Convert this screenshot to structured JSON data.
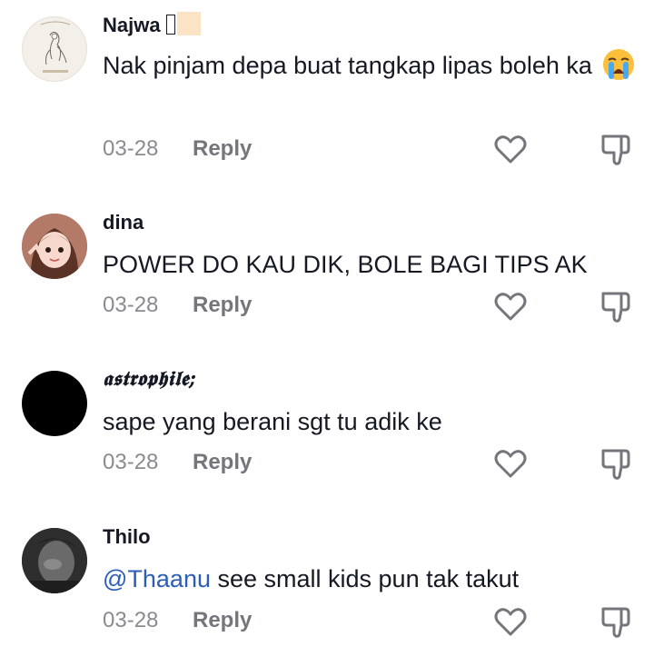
{
  "comments": [
    {
      "username": "Najwa",
      "text": "Nak pinjam depa buat tangkap lipas boleh ka",
      "emoji": "loudly-crying-face",
      "date": "03-28",
      "reply_label": "Reply"
    },
    {
      "username": "dina",
      "text": "POWER DO KAU DIK, BOLE BAGI TIPS AK",
      "date": "03-28",
      "reply_label": "Reply"
    },
    {
      "username": "𝖆𝖘𝖙𝖗𝖔𝖕𝖍𝖎𝖑𝖊;",
      "text": "sape yang berani sgt tu adik ke",
      "date": "03-28",
      "reply_label": "Reply"
    },
    {
      "username": "Thilo",
      "mention": "@Thaanu",
      "text": " see small kids pun tak takut",
      "date": "03-28",
      "reply_label": "Reply"
    }
  ],
  "colors": {
    "mention": "#2b5db9",
    "meta": "#8a8b91",
    "icon": "#75767c"
  }
}
